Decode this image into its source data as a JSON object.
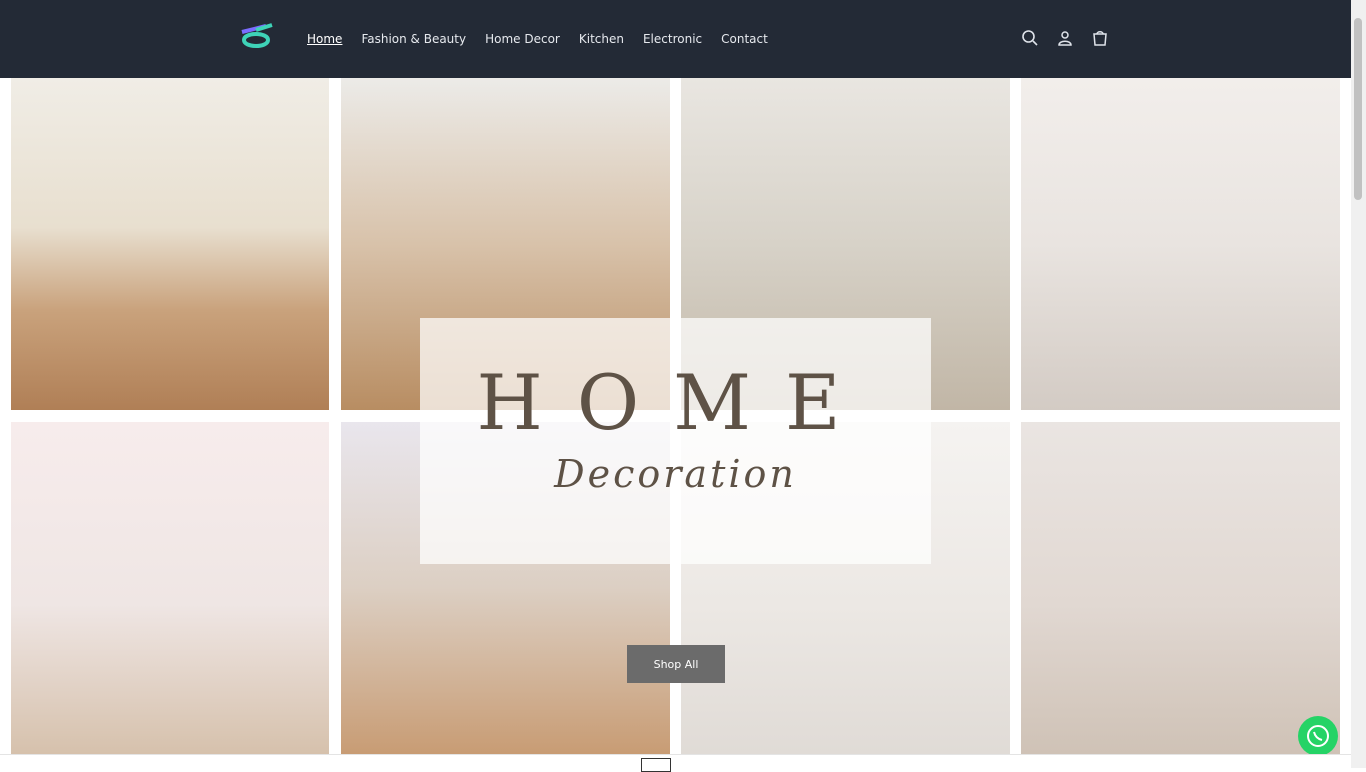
{
  "nav": [
    "Home",
    "Fashion & Beauty",
    "Home Decor",
    "Kitchen",
    "Electronic",
    "Contact"
  ],
  "hero": {
    "title": "HOME",
    "subtitle": "Decoration",
    "button": "Shop All"
  },
  "colors": {
    "header_bg": "#232a36",
    "accent_text": "#5e5246",
    "button_bg": "#6b6b6b",
    "whatsapp": "#25d366"
  }
}
